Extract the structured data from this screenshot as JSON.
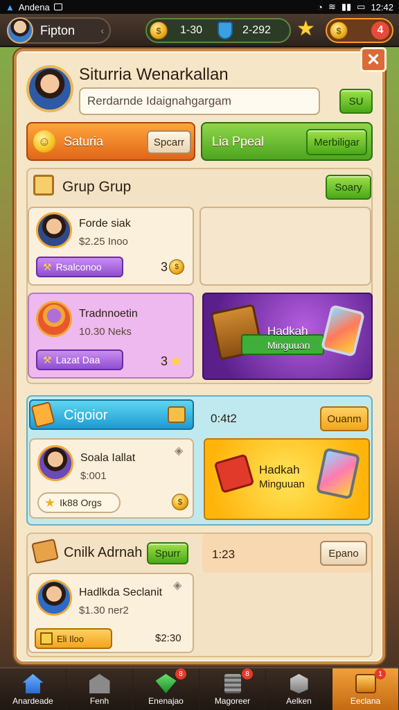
{
  "status_bar": {
    "app_name": "Andena",
    "time": "12:42"
  },
  "top_bar": {
    "profile_name": "Fipton",
    "resource_a": "1-30",
    "resource_b": "2-292",
    "gold_amount": "4"
  },
  "panel": {
    "title": "Siturria Wenarkallan",
    "search_value": "Rerdarnde Idaignahgargam",
    "search_button": "SU",
    "close_label": "✕",
    "orange_bar": {
      "label": "Saturia",
      "button": "Spcarr"
    },
    "green_bar": {
      "label": "Lia Ppeal",
      "button": "Merbiligar"
    },
    "group_section": {
      "title": "Grup Grup",
      "button": "Soary",
      "card1": {
        "name": "Forde siak",
        "value": "$2.25 Inoo",
        "tag": "Rsalconoo",
        "count": "3"
      },
      "card2": {
        "name": "Tradnnoetin",
        "value": "10.30 Neks",
        "tag": "Lazat Daa",
        "count": "3"
      },
      "promo1": {
        "title": "Hadkah",
        "subtitle": "Minguuan"
      }
    },
    "cigoior_section": {
      "title": "Cigoior",
      "timer": "0:4t2",
      "button": "Ouanm",
      "card": {
        "name": "Soala Iallat",
        "value": "$:001",
        "tag": "Ik88 Orgs"
      },
      "promo2": {
        "title": "Hadkah",
        "subtitle": "Minguuan"
      }
    },
    "adrah_section": {
      "title": "Cnilk Adrnah",
      "button": "Spurr",
      "timer": "1:23",
      "right_button": "Epano",
      "card": {
        "name": "Hadlkda Seclanit",
        "value": "$1.30 ner2",
        "tag": "Eli Iloo",
        "amount": "$2:30"
      }
    }
  },
  "dock": [
    {
      "label": "Anardeade",
      "badge": ""
    },
    {
      "label": "Fenh",
      "badge": ""
    },
    {
      "label": "Enenajao",
      "badge": "8"
    },
    {
      "label": "Magoreer",
      "badge": "8"
    },
    {
      "label": "Aelken",
      "badge": ""
    },
    {
      "label": "Eeclana",
      "badge": "1"
    }
  ],
  "colors": {
    "panel_bg": "#f6e6c8",
    "accent_orange": "#f2a51c",
    "accent_green": "#4ea520",
    "accent_purple": "#8e4ed0"
  }
}
